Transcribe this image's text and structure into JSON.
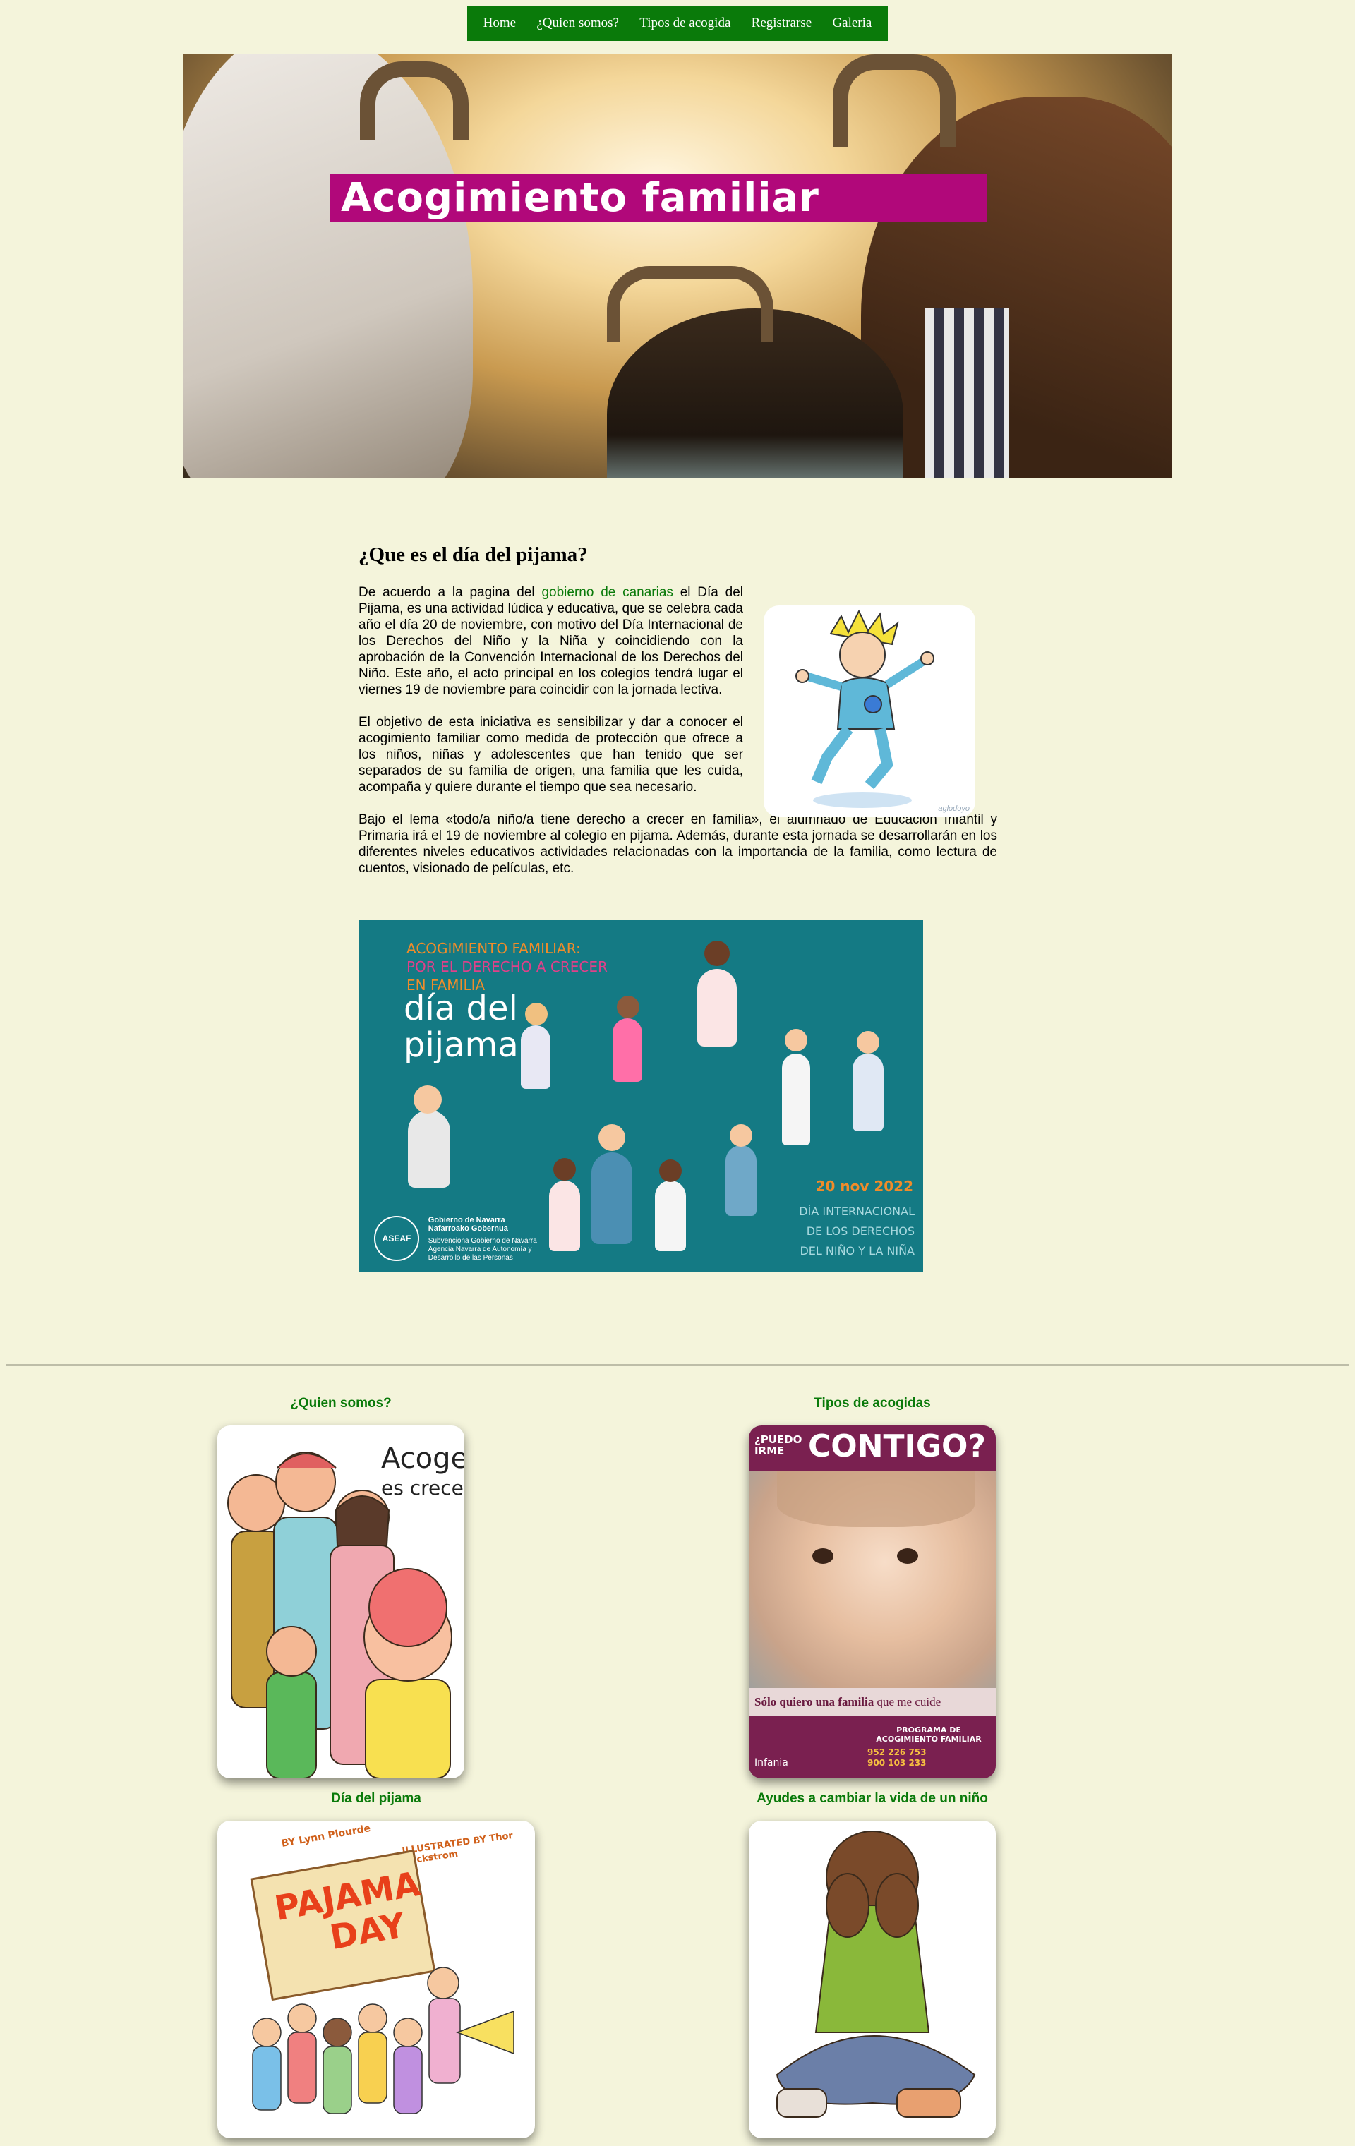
{
  "nav": {
    "items": [
      "Home",
      "¿Quien somos?",
      "Tipos de acogida",
      "Registrarse",
      "Galeria"
    ]
  },
  "hero": {
    "title": "Acogimiento familiar"
  },
  "article": {
    "heading": "¿Que es el día del pijama?",
    "p1_before": "De acuerdo a la pagina del ",
    "p1_link": "gobierno de canarias",
    "p1_after": " el Día del Pijama, es una actividad lúdica y educativa, que se celebra cada año el día 20 de noviembre, con motivo del Día Internacional de los Derechos del Niño y la Niña y coincidiendo con la aprobación de la Convención Internacional de los Derechos del Niño. Este año, el acto principal en los colegios tendrá lugar el viernes 19 de noviembre para coincidir con la jornada lectiva.",
    "p2": "El objetivo de esta iniciativa es sensibilizar y dar a conocer el acogimiento familiar como medida de protección que ofrece a los niños, niñas y adolescentes que han tenido que ser separados de su familia de origen, una familia que les cuida, acompaña y quiere durante el tiempo que sea necesario.",
    "p3": "Bajo el lema «todo/a niño/a tiene derecho a crecer en familia», el alumnado de Educación Infantil y Primaria irá el 19 de noviembre al colegio en pijama. Además, durante esta jornada se desarrollarán en los diferentes niveles educativos actividades relacionadas con la importancia de la familia, como lectura de cuentos, visionado de películas, etc.",
    "side_watermark": "aglodoyo"
  },
  "poster": {
    "kicker1": "ACOGIMIENTO FAMILIAR:",
    "kicker2": "POR EL DERECHO A CRECER",
    "kicker3": "EN FAMILIA",
    "big1": "día del",
    "big2": "pijama",
    "date": "20 nov 2022",
    "diw1": "DÍA INTERNACIONAL",
    "diw2": "DE LOS DERECHOS",
    "diw3": "DEL NIÑO Y LA NIÑA",
    "logo1": "ASEAF",
    "logo2": "Gobierno de Navarra",
    "logo3": "Nafarroako Gobernua",
    "logo4": "Subvenciona Gobierno de Navarra Agencia Navarra de Autonomía y Desarrollo de las Personas"
  },
  "cards": {
    "c1_title": "¿Quien somos?",
    "c1_text1": "Acoger",
    "c1_text2": "es crecer",
    "c2_title": "Tipos de acogidas",
    "c2_top1": "¿PUEDO",
    "c2_top2": "IRME",
    "c2_big": "CONTIGO?",
    "c2_strip_b": "Sólo quiero una familia",
    "c2_strip": " que me cuide",
    "c2_prog1": "PROGRAMA DE",
    "c2_prog2": "ACOGIMIENTO FAMILIAR",
    "c2_phone1": "952 226 753",
    "c2_phone2": "900 103 233",
    "c2_logo": "Infania",
    "c3_title": "Día del pijama",
    "c3_by": "BY Lynn Plourde",
    "c3_ill": "ILLUSTRATED BY Thor Wickstrom",
    "c3_big1": "PAJAMA",
    "c3_big2": "DAY",
    "c4_title": "Ayudes a cambiar la vida de un niño"
  },
  "colors": {
    "background": "#f4f4db",
    "nav_green": "#0a7a0a",
    "hero_magenta": "#b1087a",
    "poster_teal": "#147a84",
    "accent_orange": "#f08c2a"
  }
}
